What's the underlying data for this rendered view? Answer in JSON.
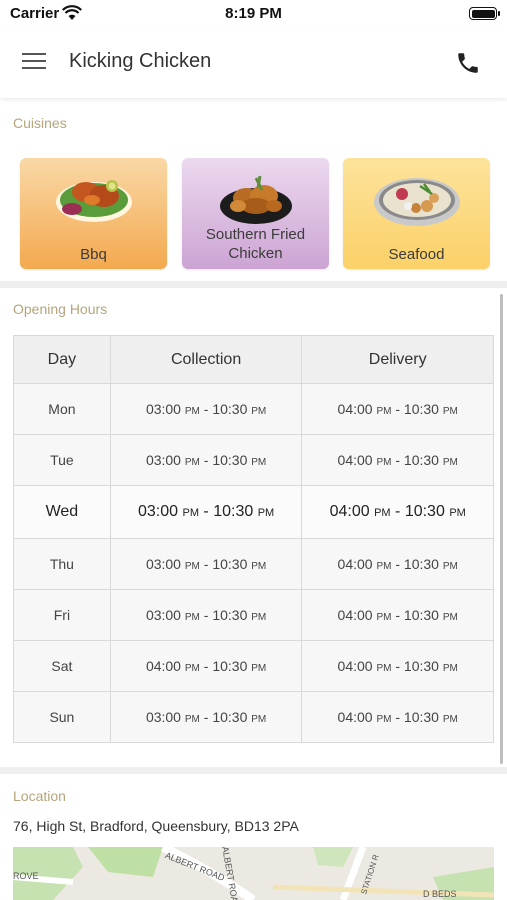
{
  "status_bar": {
    "carrier": "Carrier",
    "time": "8:19 PM"
  },
  "header": {
    "title": "Kicking Chicken"
  },
  "cuisines": {
    "label": "Cuisines",
    "items": [
      {
        "name": "Bbq"
      },
      {
        "name": "Southern Fried Chicken"
      },
      {
        "name": "Seafood"
      }
    ]
  },
  "opening_hours": {
    "label": "Opening Hours",
    "headers": {
      "day": "Day",
      "collection": "Collection",
      "delivery": "Delivery"
    },
    "rows": [
      {
        "day": "Mon",
        "collection": [
          "03:00",
          "10:30"
        ],
        "delivery": [
          "04:00",
          "10:30"
        ]
      },
      {
        "day": "Tue",
        "collection": [
          "03:00",
          "10:30"
        ],
        "delivery": [
          "04:00",
          "10:30"
        ]
      },
      {
        "day": "Wed",
        "collection": [
          "03:00",
          "10:30"
        ],
        "delivery": [
          "04:00",
          "10:30"
        ]
      },
      {
        "day": "Thu",
        "collection": [
          "03:00",
          "10:30"
        ],
        "delivery": [
          "04:00",
          "10:30"
        ]
      },
      {
        "day": "Fri",
        "collection": [
          "03:00",
          "10:30"
        ],
        "delivery": [
          "04:00",
          "10:30"
        ]
      },
      {
        "day": "Sat",
        "collection": [
          "04:00",
          "10:30"
        ],
        "delivery": [
          "04:00",
          "10:30"
        ]
      },
      {
        "day": "Sun",
        "collection": [
          "03:00",
          "10:30"
        ],
        "delivery": [
          "04:00",
          "10:30"
        ]
      }
    ],
    "highlighted_day": "Wed",
    "time_suffix": "PM"
  },
  "location": {
    "label": "Location",
    "address": "76, High St, Bradford, Queensbury, BD13 2PA",
    "map_labels": [
      "ALBERT ROAD",
      "ALBERT ROAD",
      "ROVE",
      "STATION R",
      "D BEDS"
    ]
  },
  "colors": {
    "section_label": "#b5a57d",
    "bbq_card": "#f4a94f",
    "sfc_card": "#cca4d3",
    "seafood_card": "#fbd168"
  }
}
